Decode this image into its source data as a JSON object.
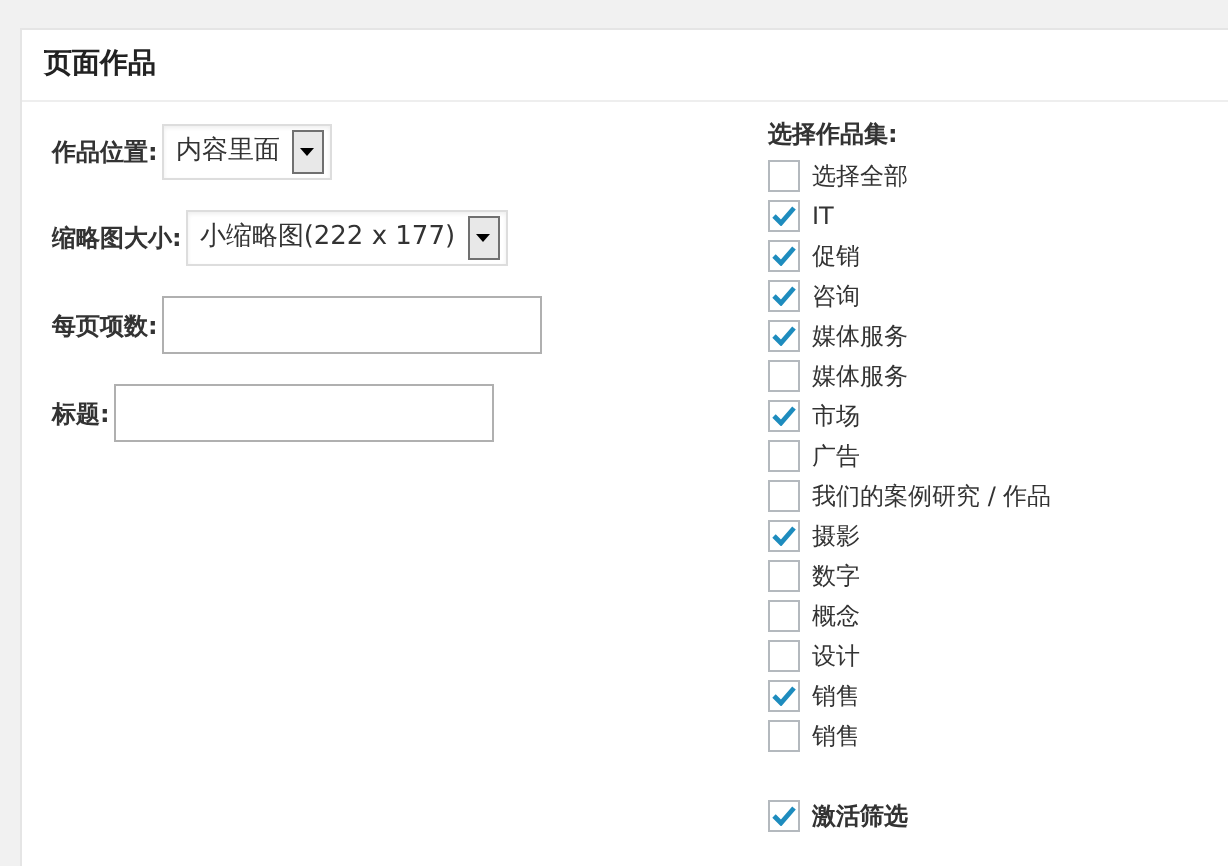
{
  "panel": {
    "title": "页面作品"
  },
  "fields": [
    {
      "kind": "select",
      "label": "作品位置:",
      "value": "内容里面"
    },
    {
      "kind": "select",
      "label": "缩略图大小:",
      "value": "小缩略图(222 x 177)"
    },
    {
      "kind": "text",
      "label": "每页项数:"
    },
    {
      "kind": "text",
      "label": "标题:"
    }
  ],
  "collections": {
    "label": "选择作品集:",
    "items": [
      {
        "label": "选择全部",
        "checked": false
      },
      {
        "label": "IT",
        "checked": true
      },
      {
        "label": "促销",
        "checked": true
      },
      {
        "label": "咨询",
        "checked": true
      },
      {
        "label": "媒体服务",
        "checked": true
      },
      {
        "label": "媒体服务",
        "checked": false
      },
      {
        "label": "市场",
        "checked": true
      },
      {
        "label": "广告",
        "checked": false
      },
      {
        "label": "我们的案例研究 / 作品",
        "checked": false
      },
      {
        "label": "摄影",
        "checked": true
      },
      {
        "label": "数字",
        "checked": false
      },
      {
        "label": "概念",
        "checked": false
      },
      {
        "label": "设计",
        "checked": false
      },
      {
        "label": "销售",
        "checked": true
      },
      {
        "label": "销售",
        "checked": false
      }
    ]
  },
  "filter": {
    "label": "激活筛选",
    "checked": true
  }
}
